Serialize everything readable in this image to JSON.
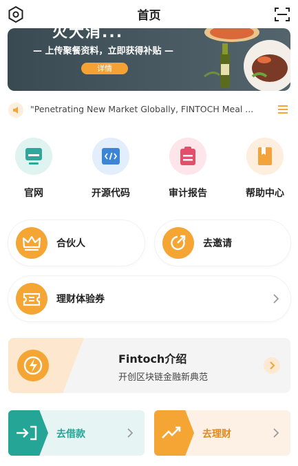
{
  "header": {
    "title": "首页",
    "left_icon": "settings-hexagon-icon",
    "right_icon": "scan-icon"
  },
  "banner": {
    "partial_title": "火大消...",
    "headline": "— 上传聚餐资料，立即获得补贴 —",
    "button_label": "详情"
  },
  "notice": {
    "text": "\"Penetrating New Market Globally, FINTOCH Meal ...",
    "menu_icon": "menu-icon"
  },
  "quick_links": [
    {
      "label": "官网",
      "icon": "monitor-icon",
      "color": "#2fa79a",
      "bg": "#dff3f0"
    },
    {
      "label": "开源代码",
      "icon": "code-icon",
      "color": "#3b84d6",
      "bg": "#e2eefb"
    },
    {
      "label": "审计报告",
      "icon": "clipboard-icon",
      "color": "#e0506b",
      "bg": "#fde5ea"
    },
    {
      "label": "帮助中心",
      "icon": "book-icon",
      "color": "#f3a33b",
      "bg": "#fdeedd"
    }
  ],
  "actions": {
    "partner_label": "合伙人",
    "invite_label": "去邀请",
    "voucher_label": "理财体验券"
  },
  "intro": {
    "title": "Fintoch介绍",
    "subtitle": "开创区块链金融新典范"
  },
  "bottom": {
    "borrow_label": "去借款",
    "invest_label": "去理财"
  },
  "colors": {
    "accent_orange": "#f4a534",
    "teal": "#24a596",
    "teal_bg": "#e6f5f3",
    "orange_bg": "#fdf0e4"
  }
}
